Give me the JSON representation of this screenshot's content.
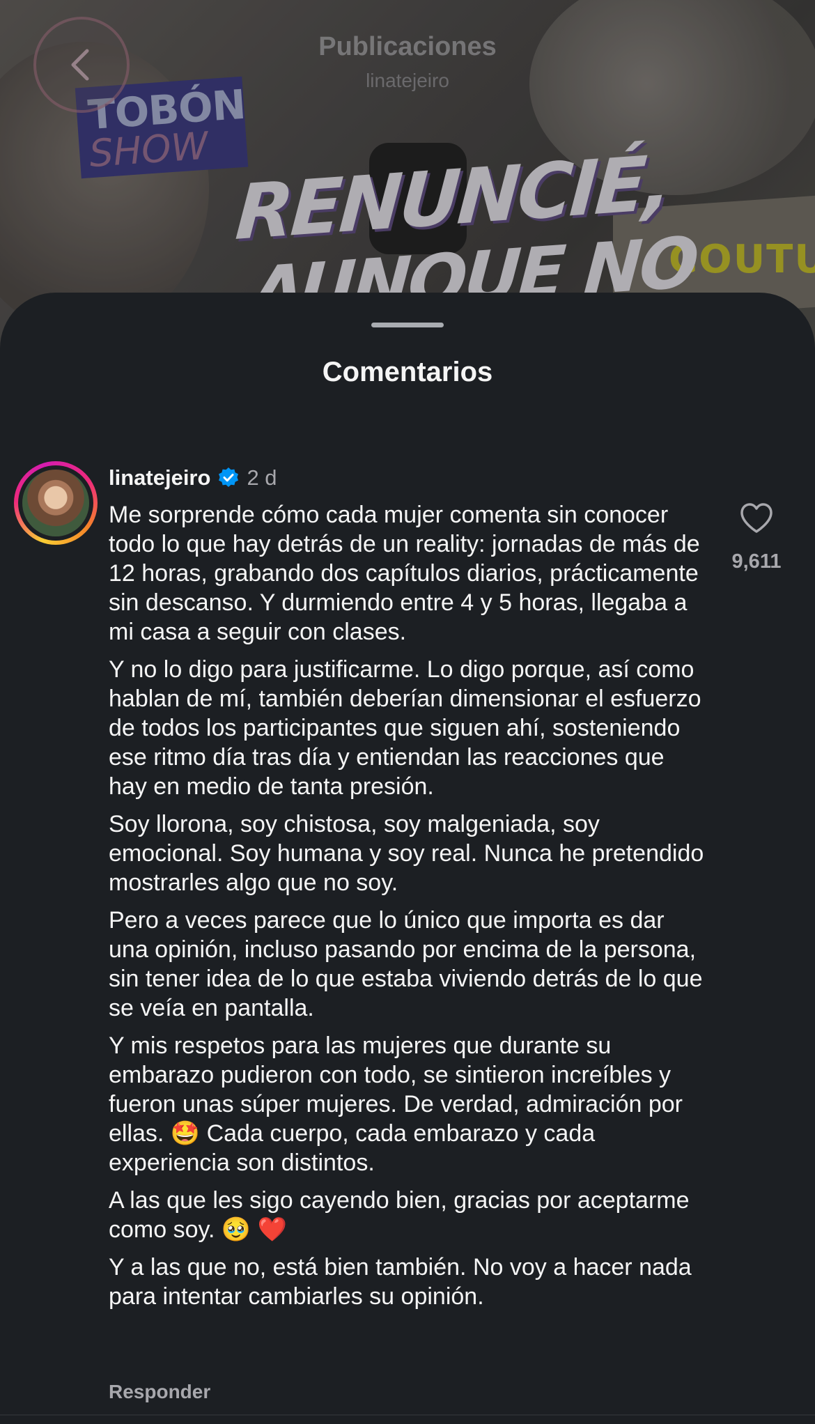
{
  "video": {
    "show_logo_line1": "TOBÓN",
    "show_logo_line2": "SHOW",
    "headline_line1": "RENUNCIÉ,",
    "headline_line2": "AUNQUE NO",
    "book_text": "COUTU"
  },
  "nav": {
    "title": "Publicaciones",
    "subtitle": "linatejeiro",
    "back_icon": "chevron-left-icon"
  },
  "sheet": {
    "title": "Comentarios"
  },
  "comment": {
    "username": "linatejeiro",
    "verified": true,
    "time": "2 d",
    "likes": "9,611",
    "reply_label": "Responder",
    "paragraphs": [
      "Me sorprende cómo cada mujer comenta sin conocer todo lo que hay detrás de un reality: jornadas de más de 12 horas, grabando dos capítulos diarios, prácticamente sin descanso. Y durmiendo entre 4 y 5 horas, llegaba a mi casa a seguir con clases.",
      "Y no lo digo para justificarme. Lo digo porque, así como hablan de mí, también deberían dimensionar el esfuerzo de todos los participantes que siguen ahí, sosteniendo ese ritmo día tras día y entiendan las reacciones que hay en medio de tanta presión.",
      "Soy llorona, soy chistosa, soy malgeniada, soy emocional. Soy humana y soy real. Nunca he pretendido mostrarles algo que no soy.",
      "Pero a veces parece que lo único que importa es dar una opinión, incluso pasando por encima de la persona, sin tener idea de lo que estaba viviendo detrás de lo que se veía en pantalla.",
      "Y mis respetos para las mujeres que durante su embarazo pudieron con todo, se sintieron increíbles y fueron unas súper mujeres. De verdad, admiración por ellas. 🤩 Cada cuerpo, cada embarazo y cada experiencia son distintos.",
      "A las que les sigo cayendo bien, gracias por aceptarme como soy. 🥹 ❤️",
      "Y a las que no, está bien también. No voy a hacer nada para intentar cambiarles su opinión."
    ]
  },
  "colors": {
    "sheet_bg": "#1c1f23",
    "text_primary": "#f5f5f5",
    "text_secondary": "#a8a8ad",
    "verified_blue": "#0095f6"
  }
}
